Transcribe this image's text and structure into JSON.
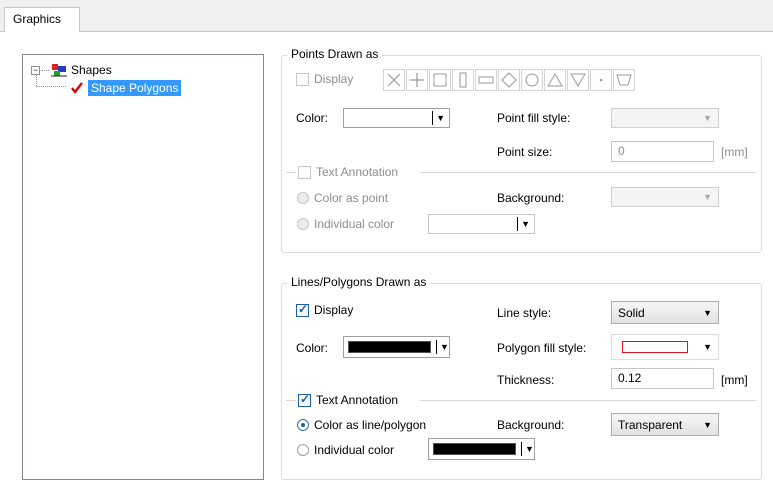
{
  "tab": {
    "label": "Graphics"
  },
  "tree": {
    "root_label": "Shapes",
    "child_label": "Shape Polygons",
    "expander": "⊟"
  },
  "points": {
    "title": "Points Drawn as",
    "display_label": "Display",
    "shape_icons": [
      "cross-icon",
      "plus-icon",
      "square-icon",
      "tall-rect-icon",
      "wide-rect-icon",
      "diamond-icon",
      "circle-icon",
      "triangle-up-icon",
      "triangle-down-icon",
      "dot-icon",
      "trapezoid-icon"
    ],
    "color_label": "Color:",
    "point_fill_label": "Point fill style:",
    "point_size_label": "Point size:",
    "point_size_value": "0",
    "unit": "[mm]",
    "text_annotation_label": "Text Annotation",
    "color_as_point_label": "Color as point",
    "individual_color_label": "Individual color",
    "background_label": "Background:"
  },
  "lines": {
    "title": "Lines/Polygons Drawn as",
    "display_label": "Display",
    "color_label": "Color:",
    "line_style_label": "Line style:",
    "line_style_value": "Solid",
    "polygon_fill_label": "Polygon fill style:",
    "thickness_label": "Thickness:",
    "thickness_value": "0.12",
    "unit": "[mm]",
    "text_annotation_label": "Text Annotation",
    "color_as_line_label": "Color as line/polygon",
    "individual_color_label": "Individual color",
    "background_label": "Background:",
    "background_value": "Transparent"
  },
  "colors": {
    "selection": "#3399ff",
    "swatch_black": "#000000",
    "fill_red": "#e0141e"
  }
}
